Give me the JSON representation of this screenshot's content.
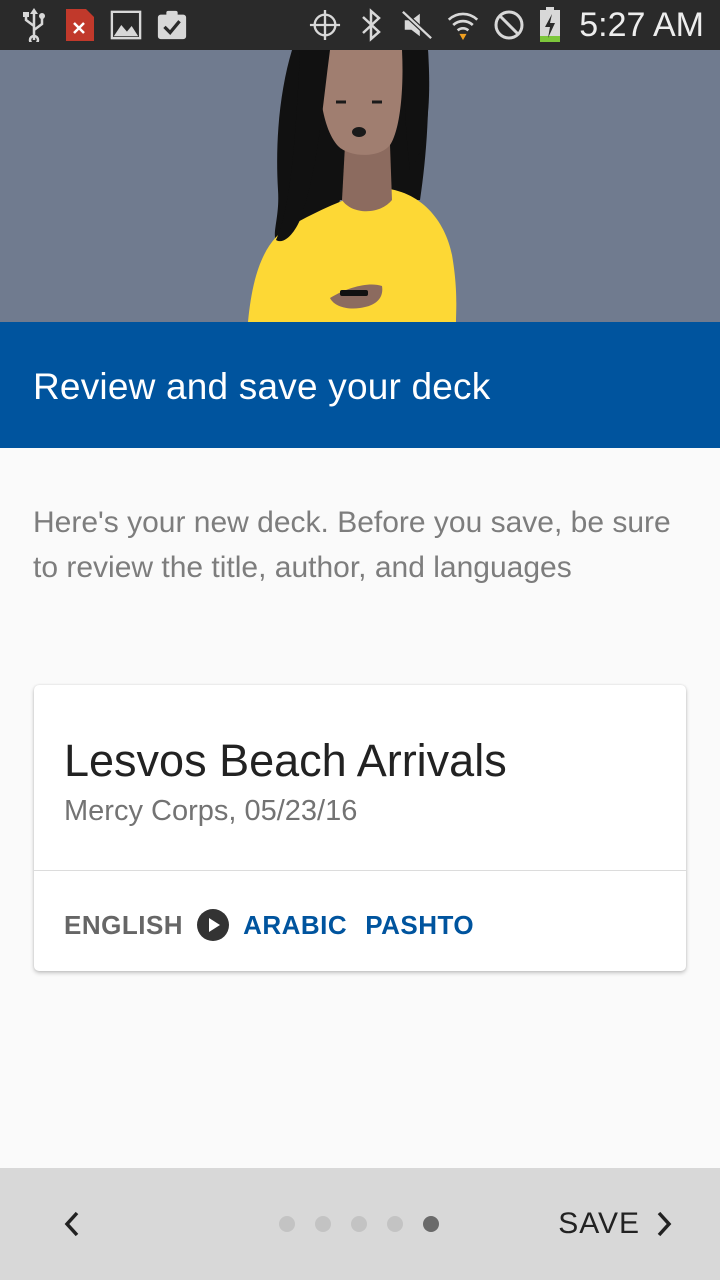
{
  "status_bar": {
    "time": "5:27 AM",
    "icons": [
      "usb-icon",
      "file-error-icon",
      "image-icon",
      "clipboard-check-icon",
      "crosshair-icon",
      "bluetooth-icon",
      "mute-icon",
      "wifi-icon",
      "do-not-disturb-icon",
      "battery-charging-icon"
    ]
  },
  "header": {
    "title": "Review and save your deck"
  },
  "intro": {
    "text": "Here's your new deck. Before you save, be sure to review the title, author, and languages"
  },
  "deck_card": {
    "title": "Lesvos Beach Arrivals",
    "meta": "Mercy Corps, 05/23/16",
    "source_language": "ENGLISH",
    "target_languages": [
      "ARABIC",
      "PASHTO"
    ]
  },
  "footer": {
    "save_label": "SAVE",
    "page_count": 5,
    "current_page": 5
  },
  "colors": {
    "accent": "#00549e",
    "hero_background": "#707b8f",
    "shirt": "#fdd835",
    "status_bar": "#2a2a2a",
    "footer": "#d8d8d8"
  }
}
